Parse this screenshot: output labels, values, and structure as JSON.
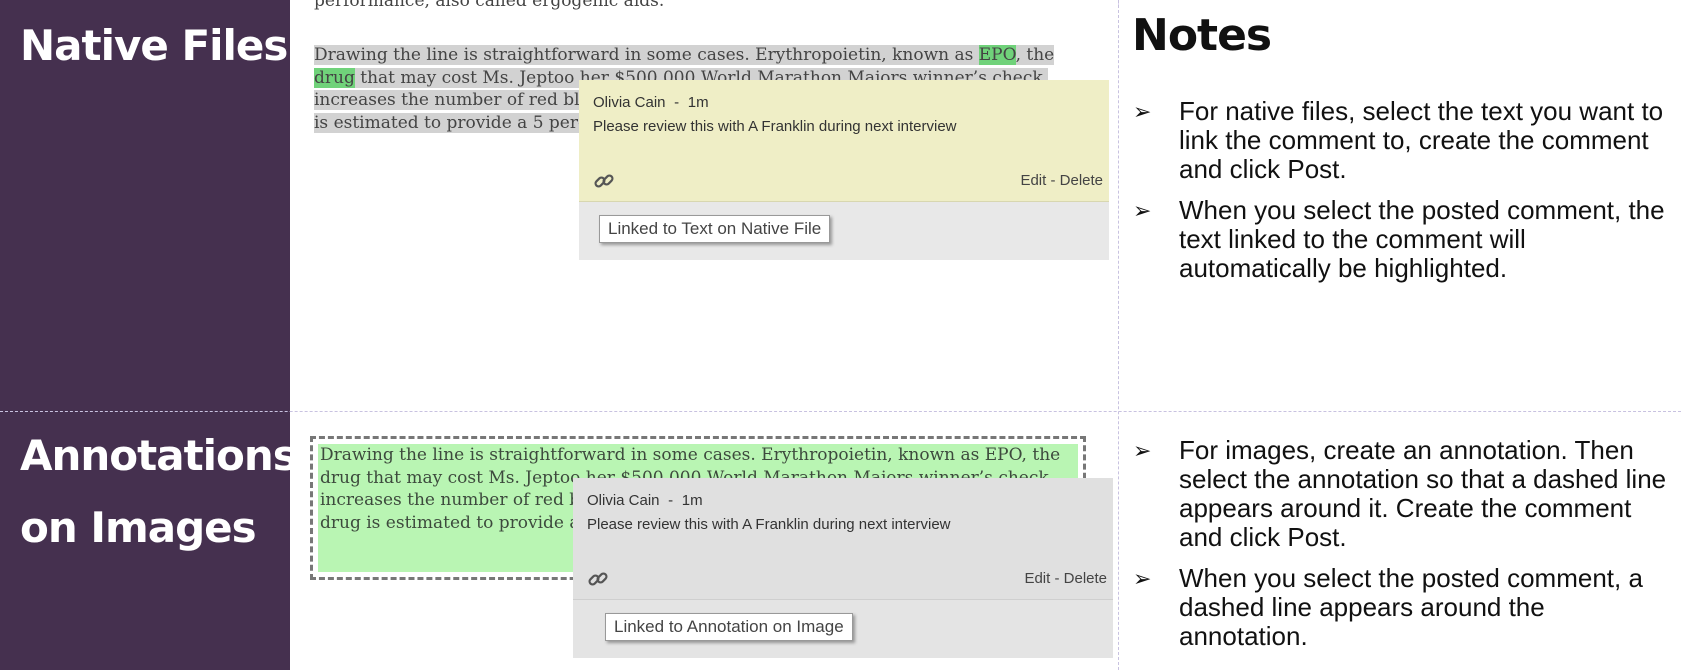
{
  "rows": [
    {
      "label": "Native Files",
      "doc": {
        "cut_text": "performance, also called ergogenic aids.",
        "p1": "Drawing the line is straightforward in some cases. Erythropoietin, known as ",
        "hl1": "EPO",
        "p2": ", the ",
        "hl2": "drug",
        "p3": " that may cost Ms. Jeptoo her $500,000 World Marathon Majors winner’s check, increases the number of red blood cells that carry oxygen to working muscles. The ",
        "hl3": "drug",
        "p4": " is estimated to provide a 5 percent to 10 percent gain in athletic performance."
      },
      "comment": {
        "author": "Olivia Cain",
        "time": "1m",
        "text": "Please review this with A Franklin during next interview",
        "edit": "Edit",
        "delete": "Delete",
        "link_label": "Linked to Text on Native File"
      },
      "notes_title": "Notes",
      "notes": [
        "For native files, select the text you want to link the comment to, create the comment and click Post.",
        "When you select the posted comment, the text linked to the comment will automatically be highlighted."
      ]
    },
    {
      "label_line1": "Annotations",
      "label_line2": "on Images",
      "doc": {
        "text": "Drawing the line is straightforward in some cases. Erythropoietin, known as EPO, the drug that may cost Ms. Jeptoo her $500,000 World Marathon Majors winner’s check, increases the number of red blood cells that carry oxygen to working muscles. The drug is estimated to provide a 5 percent to 10 percent gain in athletic performance."
      },
      "comment": {
        "author": "Olivia Cain",
        "time": "1m",
        "text": "Please review this with A Franklin during next interview",
        "edit": "Edit",
        "delete": "Delete",
        "link_label": "Linked to Annotation on Image"
      },
      "notes": [
        "For images, create an annotation. Then select the annotation so that a dashed line appears around it. Create the comment and click Post.",
        "When you select the posted comment, a dashed line appears around the annotation."
      ]
    }
  ],
  "colors": {
    "label_bg": "#45304f",
    "comment_active_bg": "#efeec6",
    "comment_bg": "#e0e0e0",
    "annotation_fill": "#b9f5b3",
    "highlight_green": "#70d27a"
  },
  "icons": {
    "bullet": "➢",
    "link": "🔗"
  }
}
